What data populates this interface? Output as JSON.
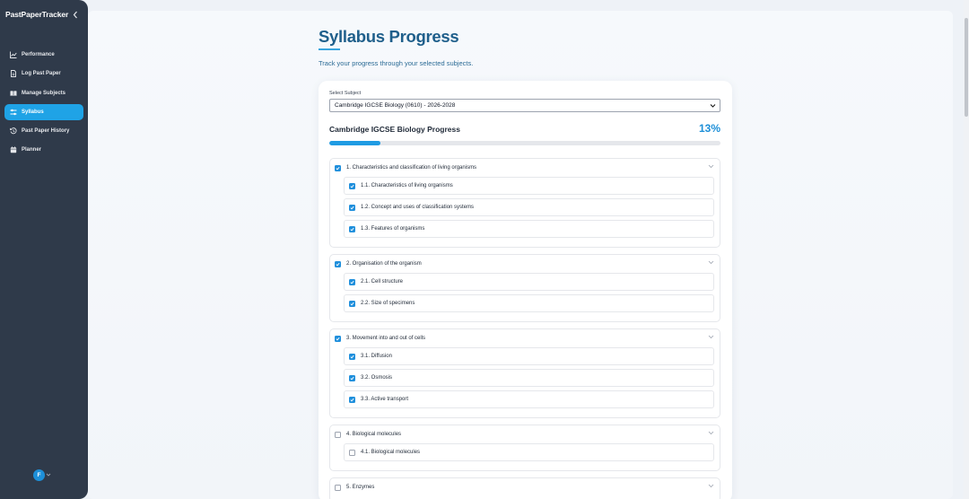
{
  "app": {
    "brand": "PastPaperTracker"
  },
  "sidebar": {
    "items": [
      {
        "label": "Performance",
        "icon": "chart-line-icon",
        "active": false
      },
      {
        "label": "Log Past Paper",
        "icon": "document-icon",
        "active": false
      },
      {
        "label": "Manage Subjects",
        "icon": "book-icon",
        "active": false
      },
      {
        "label": "Syllabus",
        "icon": "sliders-icon",
        "active": true
      },
      {
        "label": "Past Paper History",
        "icon": "history-icon",
        "active": false
      },
      {
        "label": "Planner",
        "icon": "calendar-icon",
        "active": false
      }
    ],
    "user_initial": "F"
  },
  "page": {
    "title": "Syllabus Progress",
    "subtitle": "Track your progress through your selected subjects."
  },
  "subject_select": {
    "label": "Select Subject",
    "value": "Cambridge IGCSE Biology (0610) - 2026-2028"
  },
  "progress": {
    "title": "Cambridge IGCSE Biology Progress",
    "percent_label": "13%",
    "fraction": 0.13
  },
  "topics": [
    {
      "label": "1. Characteristics and classification of living organisms",
      "checked": true,
      "subtopics": [
        {
          "label": "1.1. Characteristics of living organisms",
          "checked": true
        },
        {
          "label": "1.2. Concept and uses of classification systems",
          "checked": true
        },
        {
          "label": "1.3. Features of organisms",
          "checked": true
        }
      ]
    },
    {
      "label": "2. Organisation of the organism",
      "checked": true,
      "subtopics": [
        {
          "label": "2.1. Cell structure",
          "checked": true
        },
        {
          "label": "2.2. Size of specimens",
          "checked": true
        }
      ]
    },
    {
      "label": "3. Movement into and out of cells",
      "checked": true,
      "subtopics": [
        {
          "label": "3.1. Diffusion",
          "checked": true
        },
        {
          "label": "3.2. Osmosis",
          "checked": true
        },
        {
          "label": "3.3. Active transport",
          "checked": true
        }
      ]
    },
    {
      "label": "4. Biological molecules",
      "checked": false,
      "subtopics": [
        {
          "label": "4.1. Biological molecules",
          "checked": false
        }
      ]
    },
    {
      "label": "5. Enzymes",
      "checked": false,
      "subtopics": []
    }
  ],
  "colors": {
    "accent": "#1f9be3",
    "sidebar": "#2f3a4a",
    "title": "#1f5f8b"
  }
}
